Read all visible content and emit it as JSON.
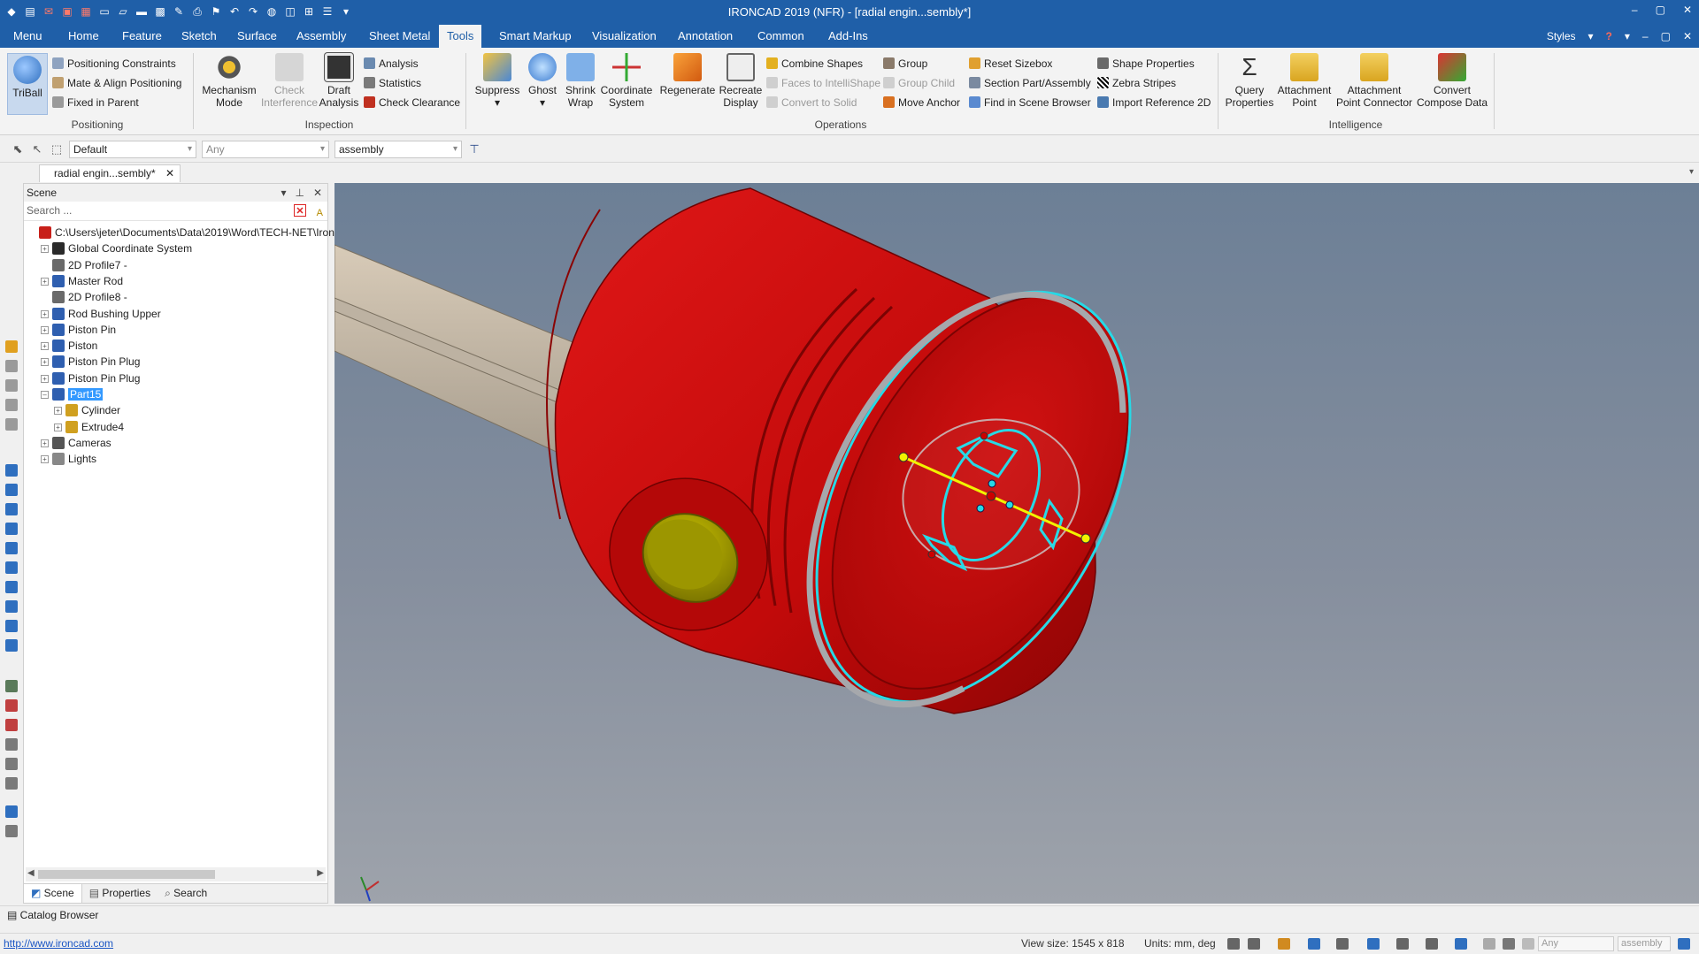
{
  "app": {
    "title": "IRONCAD 2019 (NFR) - [radial engin...sembly*]",
    "window_controls": [
      "–",
      "▢",
      "✕"
    ]
  },
  "menu": {
    "tabs": [
      "Menu",
      "Home",
      "Feature",
      "Sketch",
      "Surface",
      "Assembly",
      "Sheet Metal",
      "Tools",
      "Smart Markup",
      "Visualization",
      "Annotation",
      "Common",
      "Add-Ins"
    ],
    "active_tab": "Tools",
    "styles_label": "Styles",
    "help_label": "?"
  },
  "ribbon": {
    "positioning": {
      "label": "Positioning",
      "triball": "TriBall",
      "positioning_constraints": "Positioning Constraints",
      "mate_align": "Mate & Align Positioning",
      "fixed_in_parent": "Fixed in Parent"
    },
    "inspection": {
      "label": "Inspection",
      "mechanism_1": "Mechanism",
      "mechanism_2": "Mode",
      "check_1": "Check",
      "check_2": "Interference",
      "draft_1": "Draft",
      "draft_2": "Analysis",
      "analysis": "Analysis",
      "statistics": "Statistics",
      "check_clearance": "Check Clearance"
    },
    "operations": {
      "label": "Operations",
      "suppress": "Suppress",
      "ghost": "Ghost",
      "shrink_1": "Shrink",
      "shrink_2": "Wrap",
      "coord_1": "Coordinate",
      "coord_2": "System",
      "regenerate": "Regenerate",
      "recreate_1": "Recreate",
      "recreate_2": "Display",
      "combine_shapes": "Combine Shapes",
      "faces_to_intellishape": "Faces to IntelliShape",
      "convert_to_solid": "Convert to Solid",
      "group": "Group",
      "group_child": "Group Child",
      "move_anchor": "Move Anchor",
      "reset_sizebox": "Reset Sizebox",
      "section_part": "Section Part/Assembly",
      "find_in_scene": "Find in Scene Browser",
      "shape_properties": "Shape Properties",
      "zebra_stripes": "Zebra Stripes",
      "import_reference": "Import Reference 2D"
    },
    "intelligence": {
      "label": "Intelligence",
      "query_1": "Query",
      "query_2": "Properties",
      "attach_1": "Attachment",
      "attach_2": "Point",
      "apc_1": "Attachment",
      "apc_2": "Point Connector",
      "convert_1": "Convert",
      "convert_2": "Compose Data"
    }
  },
  "selbar": {
    "style_combo": "Default",
    "filter_combo": "Any",
    "level_combo": "assembly"
  },
  "doc_tab": {
    "label": "radial engin...sembly*",
    "close": "✕"
  },
  "scene": {
    "title": "Scene",
    "search_placeholder": "Search ...",
    "tree": [
      {
        "label": "C:\\Users\\jeter\\Documents\\Data\\2019\\Word\\TECH-NET\\Iron",
        "level": 0,
        "icon": "assembly-root-icon",
        "expander": ""
      },
      {
        "label": "Global Coordinate System",
        "level": 1,
        "icon": "coordinate-system-icon",
        "expander": "+"
      },
      {
        "label": "2D Profile7 -",
        "level": 1,
        "icon": "profile-icon",
        "expander": ""
      },
      {
        "label": "Master Rod",
        "level": 1,
        "icon": "part-icon",
        "expander": "+"
      },
      {
        "label": "2D Profile8 -",
        "level": 1,
        "icon": "profile-icon",
        "expander": ""
      },
      {
        "label": "Rod Bushing Upper",
        "level": 1,
        "icon": "part-icon",
        "expander": "+"
      },
      {
        "label": "Piston Pin",
        "level": 1,
        "icon": "part-icon",
        "expander": "+"
      },
      {
        "label": "Piston",
        "level": 1,
        "icon": "part-icon",
        "expander": "+"
      },
      {
        "label": "Piston Pin Plug",
        "level": 1,
        "icon": "part-icon",
        "expander": "+"
      },
      {
        "label": "Piston Pin Plug",
        "level": 1,
        "icon": "part-icon",
        "expander": "+"
      },
      {
        "label": "Part15",
        "level": 1,
        "icon": "part-icon",
        "expander": "–",
        "selected": true
      },
      {
        "label": "Cylinder",
        "level": 2,
        "icon": "intellishape-icon",
        "expander": "+"
      },
      {
        "label": "Extrude4",
        "level": 2,
        "icon": "intellishape-icon",
        "expander": "+"
      },
      {
        "label": "Cameras",
        "level": 1,
        "icon": "camera-icon",
        "expander": "+"
      },
      {
        "label": "Lights",
        "level": 1,
        "icon": "light-icon",
        "expander": "+"
      }
    ],
    "tabs": [
      "Scene",
      "Properties",
      "Search"
    ]
  },
  "catalog": {
    "label": "Catalog Browser"
  },
  "status": {
    "url": "http://www.ironcad.com",
    "view_size": "View size: 1545 x  818",
    "units": "Units: mm, deg",
    "combo_any": "Any",
    "combo_assembly": "assembly"
  },
  "colors": {
    "titlebar": "#1f5fa8",
    "piston_red": "#c40a0a",
    "highlight_cyan": "#27d9e6",
    "plug_yellow": "#a8a400"
  }
}
